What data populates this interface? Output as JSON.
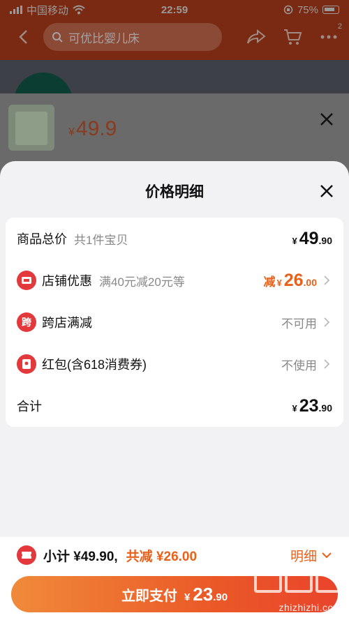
{
  "status_bar": {
    "carrier": "中国移动",
    "time": "22:59",
    "battery": "75%"
  },
  "nav": {
    "search_placeholder": "可优比婴儿床",
    "cart_badge": "2"
  },
  "sku": {
    "currency": "¥",
    "price": "49.9"
  },
  "sheet": {
    "title": "价格明细",
    "rows": [
      {
        "label": "商品总价",
        "sub": "共1件宝贝",
        "currency": "¥",
        "int": "49",
        "dec": ".90"
      },
      {
        "label": "店铺优惠",
        "sub": "满40元减20元等",
        "prefix": "减",
        "currency": "¥",
        "int": "26",
        "dec": ".00",
        "icon": "shop-coupon-icon"
      },
      {
        "label": "跨店满减",
        "value": "不可用",
        "icon_text": "跨"
      },
      {
        "label": "红包(含618消费券)",
        "value": "不使用",
        "icon": "red-packet-icon"
      },
      {
        "label": "合计",
        "currency": "¥",
        "int": "23",
        "dec": ".90"
      }
    ]
  },
  "bottom": {
    "subtotal": "小计 ¥49.90,",
    "discount": "共减 ¥26.00",
    "detail": "明细",
    "pay_label": "立即支付",
    "pay_currency": "¥",
    "pay_int": "23",
    "pay_dec": ".90"
  },
  "watermark": {
    "text": "zhizhizhi.com"
  },
  "colors": {
    "accent_orange": "#e8611a",
    "accent_red": "#e4393c"
  }
}
